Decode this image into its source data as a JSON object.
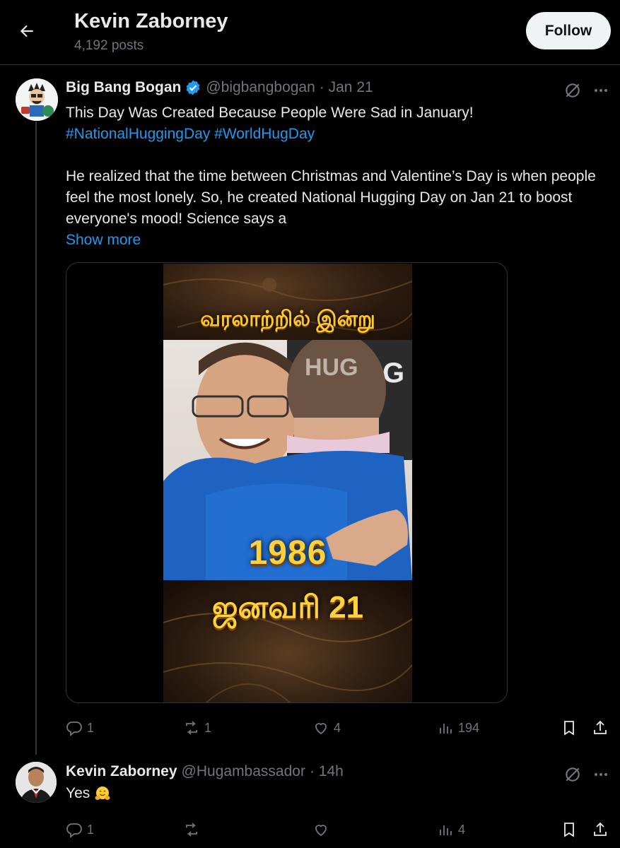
{
  "header": {
    "title": "Kevin Zaborney",
    "posts_count": "4,192 posts",
    "follow_label": "Follow"
  },
  "tweet": {
    "author_name": "Big Bang Bogan",
    "author_handle": "@bigbangbogan",
    "date": "· Jan 21",
    "line1": "This Day Was Created Because People Were Sad in January!",
    "hashtags": "#NationalHuggingDay #WorldHugDay",
    "line2": "He realized that the time between Christmas and Valentine’s Day is when people feel the most lonely. So, he created National Hugging Day on Jan 21 to boost everyone's mood! Science says a",
    "show_more": "Show more",
    "media": {
      "tamil_title": "வரலாற்றில் இன்று",
      "year": "1986",
      "tamil_date": "ஜனவரி 21",
      "shirt_text": "HUG"
    },
    "stats": {
      "replies": "1",
      "reposts": "1",
      "likes": "4",
      "views": "194"
    }
  },
  "reply": {
    "author_name": "Kevin Zaborney",
    "author_handle": "@Hugambassador",
    "time": "· 14h",
    "text": "Yes",
    "stats": {
      "replies": "1",
      "reposts": "",
      "likes": "",
      "views": "4"
    }
  },
  "colors": {
    "accent": "#1d9bf0",
    "muted": "#71767b",
    "background": "#000000",
    "follow_bg": "#eff3f4"
  }
}
